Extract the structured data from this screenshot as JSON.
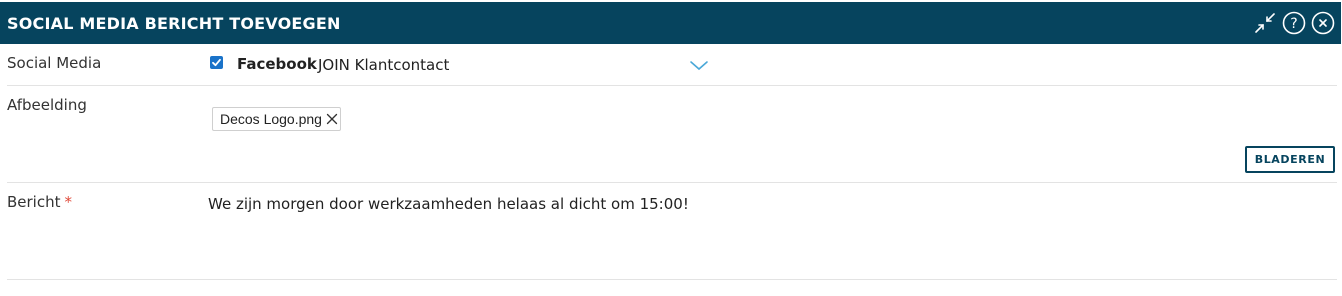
{
  "dialog": {
    "title": "SOCIAL MEDIA BERICHT TOEVOEGEN",
    "icons": [
      "collapse-icon",
      "help-icon",
      "close-icon"
    ],
    "accent_color": "#06445e"
  },
  "social_media": {
    "label": "Social Media",
    "checked": true,
    "platform": "Facebook",
    "page": "JOIN Klantcontact"
  },
  "image": {
    "label": "Afbeelding",
    "file_name": "Decos Logo.png",
    "browse_label": "BLADEREN"
  },
  "message": {
    "label": "Bericht",
    "required_mark": "*",
    "value": "We zijn morgen door werkzaamheden helaas al dicht om 15:00!"
  }
}
